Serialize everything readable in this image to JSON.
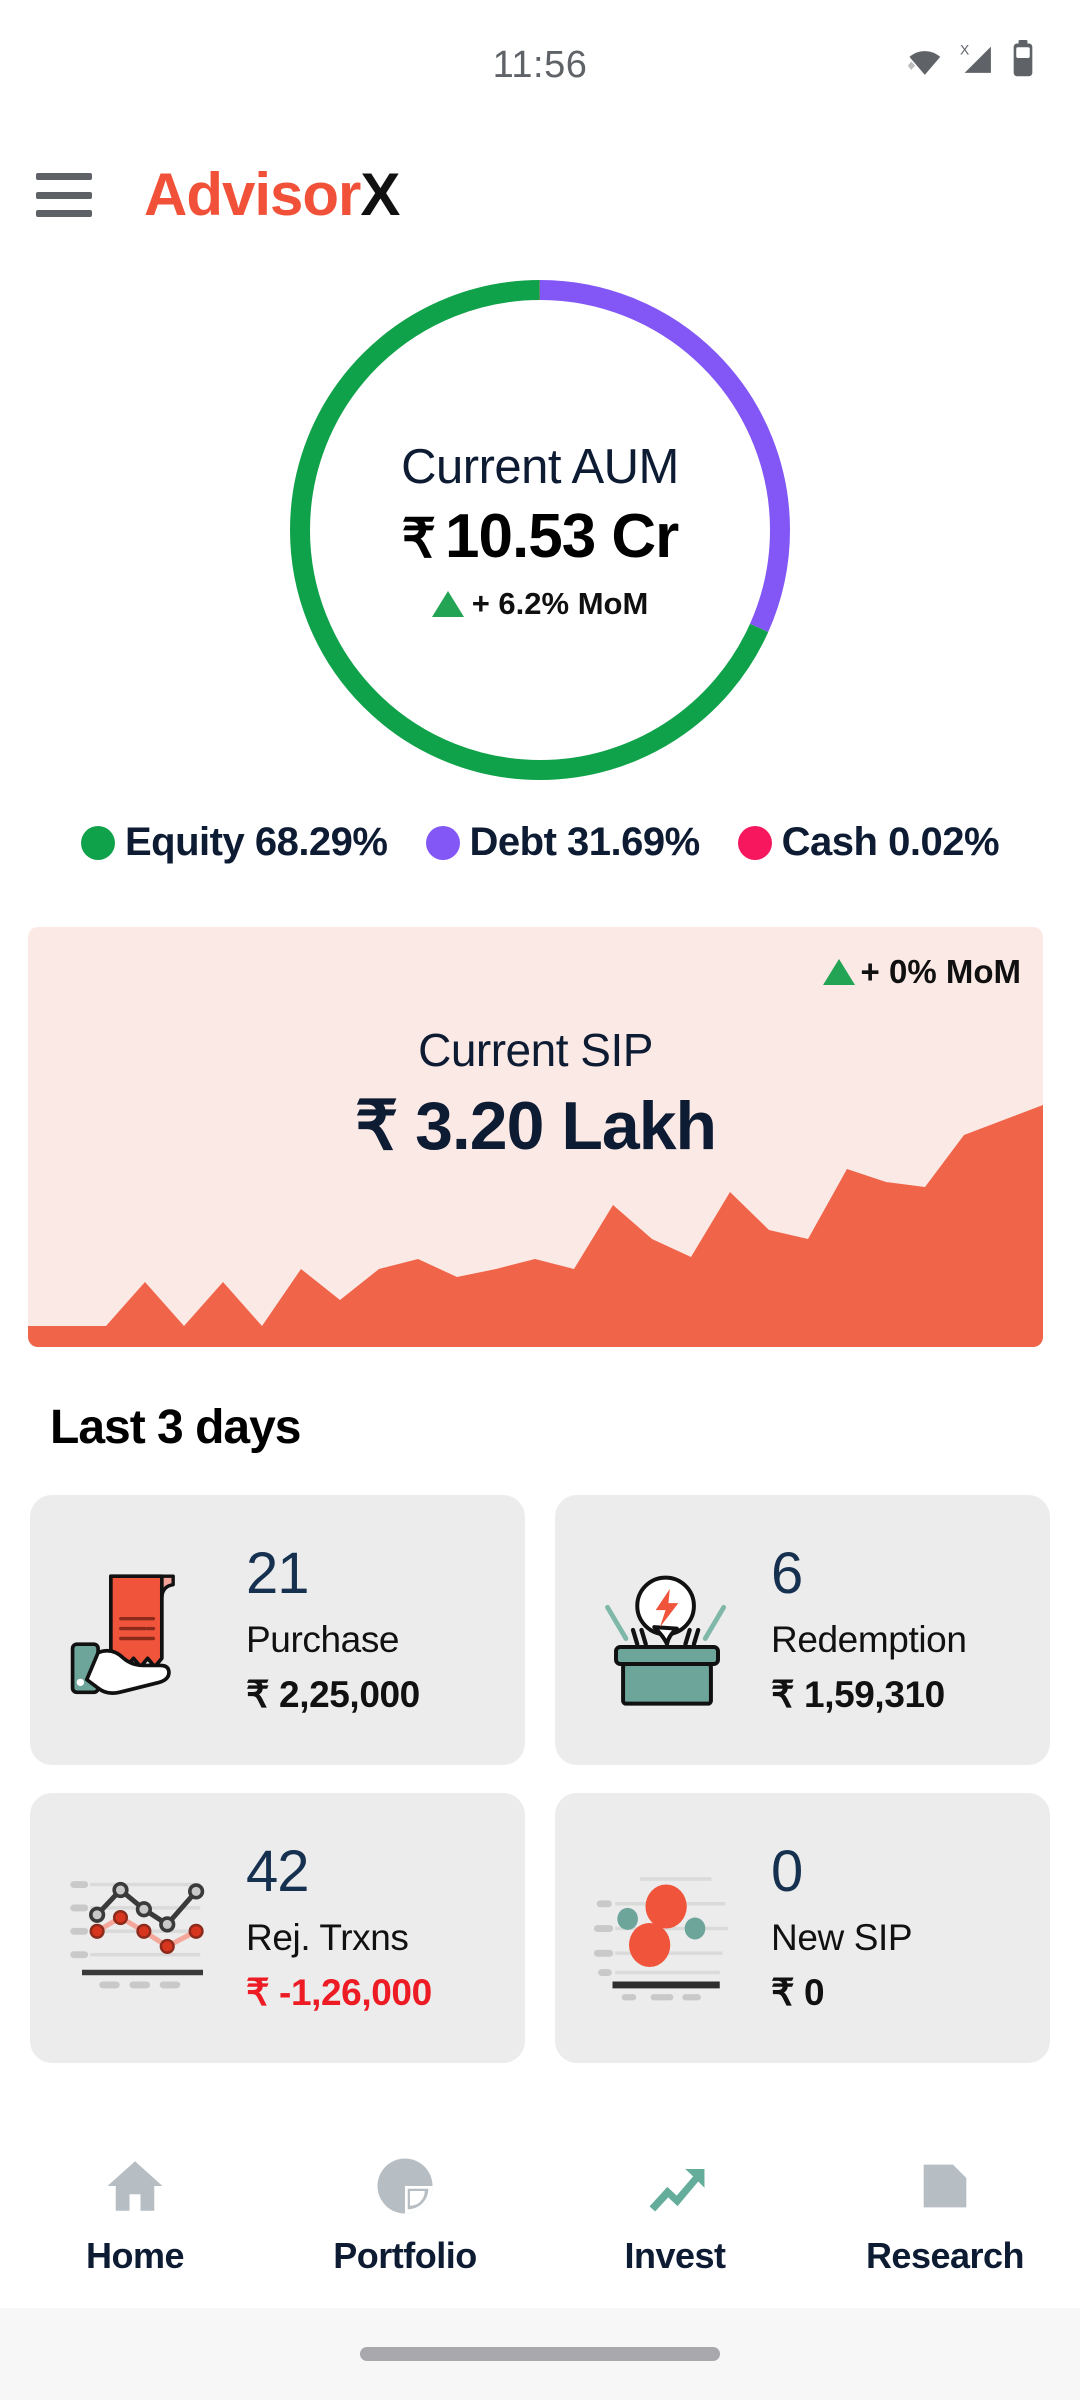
{
  "status_bar": {
    "time": "11:56",
    "icons": [
      "wifi-icon",
      "signal-no-sim-icon",
      "battery-icon"
    ]
  },
  "app_bar": {
    "menu_icon": "hamburger-menu-icon",
    "brand_primary": "Advisor",
    "brand_secondary": "X",
    "brand_primary_color": "#F05138",
    "brand_secondary_color": "#111111"
  },
  "aum": {
    "label": "Current AUM",
    "rupee": "₹",
    "value": "10.53 Cr",
    "delta": "+ 6.2% MoM",
    "delta_direction": "up",
    "delta_icon": "triangle-up-icon"
  },
  "legend": [
    {
      "label": "Equity 68.29%",
      "color": "#10A24A",
      "dot": "legend-dot-equity"
    },
    {
      "label": "Debt 31.69%",
      "color": "#8257F5",
      "dot": "legend-dot-debt"
    },
    {
      "label": "Cash 0.02%",
      "color": "#F7175F",
      "dot": "legend-dot-cash"
    }
  ],
  "sip": {
    "title": "Current SIP",
    "value": "₹ 3.20 Lakh",
    "delta": "+ 0% MoM",
    "delta_direction": "up",
    "card_bg": "#FBE9E5",
    "area_color": "#F06449"
  },
  "last3days": {
    "title": "Last 3 days",
    "cards": [
      {
        "icon": "receipt-in-hand-icon",
        "count": "21",
        "label": "Purchase",
        "amount": "₹ 2,25,000",
        "negative": false
      },
      {
        "icon": "box-open-bolt-icon",
        "count": "6",
        "label": "Redemption",
        "amount": "₹ 1,59,310",
        "negative": false
      },
      {
        "icon": "line-chart-icon",
        "count": "42",
        "label": "Rej. Trxns",
        "amount": "₹ -1,26,000",
        "negative": true
      },
      {
        "icon": "bubble-chart-icon",
        "count": "0",
        "label": "New SIP",
        "amount": "₹ 0",
        "negative": false
      }
    ]
  },
  "bottom_nav": {
    "items": [
      {
        "label": "Home",
        "icon": "home-icon",
        "active": false,
        "color": "#B6BEC4"
      },
      {
        "label": "Portfolio",
        "icon": "pie-chart-icon",
        "active": false,
        "color": "#B6BEC4"
      },
      {
        "label": "Invest",
        "icon": "trending-up-icon",
        "active": true,
        "color": "#65AD9B"
      },
      {
        "label": "Research",
        "icon": "folder-icon",
        "active": false,
        "color": "#B6BEC4"
      }
    ]
  },
  "chart_data": [
    {
      "type": "pie",
      "title": "Current AUM allocation",
      "labels": [
        "Equity",
        "Debt",
        "Cash"
      ],
      "values": [
        68.29,
        31.69,
        0.02
      ],
      "colors": [
        "#10A24A",
        "#8257F5",
        "#F7175F"
      ],
      "unit": "percent",
      "donut": true,
      "start_angle_deg": 0,
      "legend_position": "below"
    },
    {
      "type": "area",
      "title": "Current SIP trend",
      "series": [
        {
          "name": "SIP",
          "values": [
            8,
            8,
            8,
            17,
            8,
            17,
            8,
            22,
            14,
            22,
            24,
            20,
            22,
            24,
            22,
            38,
            30,
            26,
            45,
            33,
            30,
            52,
            48,
            46,
            70,
            100
          ]
        }
      ],
      "ylabel": "",
      "xlabel": "",
      "grid": false,
      "fill_color": "#F06449",
      "background": "#FBE9E5"
    }
  ]
}
